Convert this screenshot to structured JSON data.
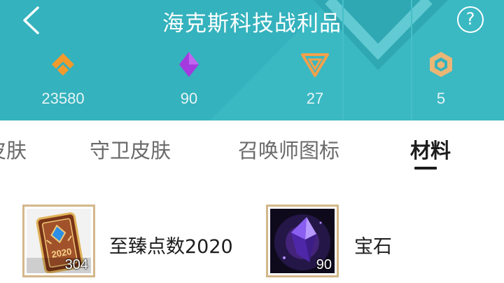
{
  "header": {
    "title": "海克斯科技战利品",
    "background_color": "#34b2bd",
    "back_icon": "chevron-left-icon",
    "help_icon": "question-circle-icon",
    "help_label": "?"
  },
  "currencies": [
    {
      "name": "blue-essence",
      "icon": "blue-essence-icon",
      "color": "#f39a2d",
      "value": "23580"
    },
    {
      "name": "gemstone",
      "icon": "purple-diamond-icon",
      "color": "#a43be0",
      "value": "90"
    },
    {
      "name": "orange-essence",
      "icon": "orange-triangle-icon",
      "color": "#f3a14a",
      "value": "27"
    },
    {
      "name": "mythic-essence",
      "icon": "hexagon-essence-icon",
      "color": "#e9b676",
      "value": "5"
    }
  ],
  "tabs": [
    {
      "label": "皮肤",
      "active": false
    },
    {
      "label": "守卫皮肤",
      "active": false
    },
    {
      "label": "召唤师图标",
      "active": false
    },
    {
      "label": "材料",
      "active": true
    }
  ],
  "items": [
    {
      "name": "至臻点数2020",
      "icon": "prestige-points-2020-icon",
      "quantity": "304",
      "badge_text": "2020"
    },
    {
      "name": "宝石",
      "icon": "gemstone-icon",
      "quantity": "90"
    }
  ]
}
